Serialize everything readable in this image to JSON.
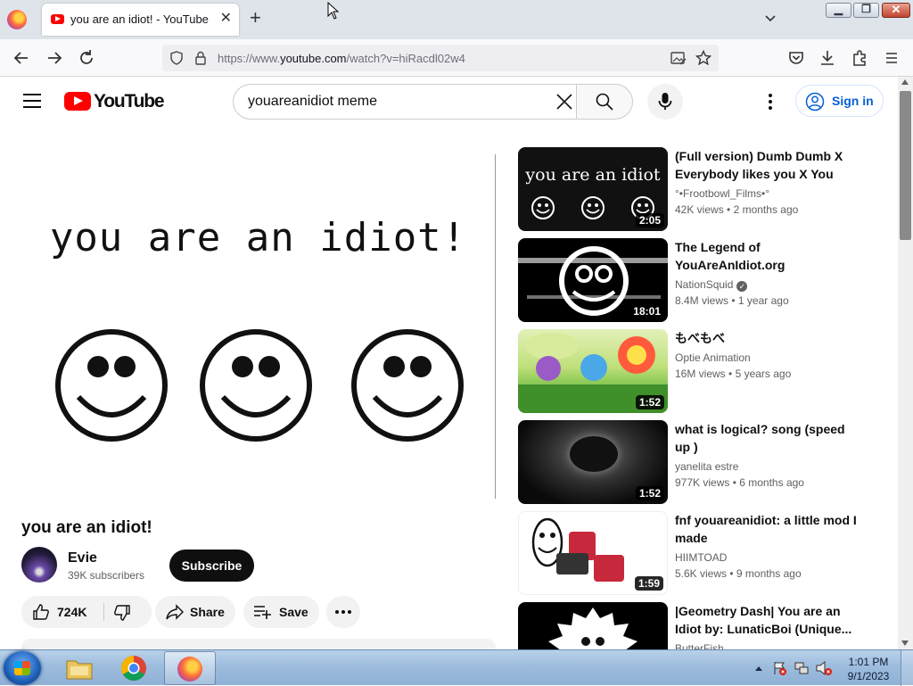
{
  "browser": {
    "tab_title": "you are an idiot! - YouTube",
    "new_tab": "+",
    "tab_close": "✕",
    "url_prefix": "https://www.",
    "url_domain": "youtube.com",
    "url_path": "/watch?v=hiRacdl02w4"
  },
  "header": {
    "logo_text": "YouTube",
    "search_value": "youareanidiot meme",
    "sign_in": "Sign in"
  },
  "player": {
    "screen_text": "you are an idiot!"
  },
  "video": {
    "title": "you are an idiot!",
    "channel": "Evie",
    "subscribers": "39K subscribers",
    "subscribe_label": "Subscribe",
    "likes": "724K",
    "share_label": "Share",
    "save_label": "Save"
  },
  "recommendations": [
    {
      "title": "(Full version) Dumb Dumb X Everybody likes you X You are...",
      "channel": "°•Frootbowl_Films•°",
      "views": "42K views",
      "age": "2 months ago",
      "duration": "2:05",
      "verified": false
    },
    {
      "title": "The Legend of YouAreAnIdiot.org",
      "channel": "NationSquid",
      "views": "8.4M views",
      "age": "1 year ago",
      "duration": "18:01",
      "verified": true
    },
    {
      "title": "もべもべ",
      "channel": "Optie Animation",
      "views": "16M views",
      "age": "5 years ago",
      "duration": "1:52",
      "verified": false
    },
    {
      "title": "what is logical? song (speed up )",
      "channel": "yanelita estre",
      "views": "977K views",
      "age": "6 months ago",
      "duration": "1:52",
      "verified": false
    },
    {
      "title": "fnf youareanidiot: a little mod I made",
      "channel": "HIIMTOAD",
      "views": "5.6K views",
      "age": "9 months ago",
      "duration": "1:59",
      "verified": false
    },
    {
      "title": "|Geometry Dash| You are an Idiot by: LunaticBoi (Unique...",
      "channel": "ButterFish",
      "views": "",
      "age": "",
      "duration": "",
      "verified": false
    }
  ],
  "recommendation_thumb_texts": {
    "r1": "you are an idiot"
  },
  "taskbar": {
    "time": "1:01 PM",
    "date": "9/1/2023"
  },
  "colors": {
    "yt_red": "#ff0000",
    "link_blue": "#065fd4",
    "taskbar": "#9dbcdd"
  }
}
